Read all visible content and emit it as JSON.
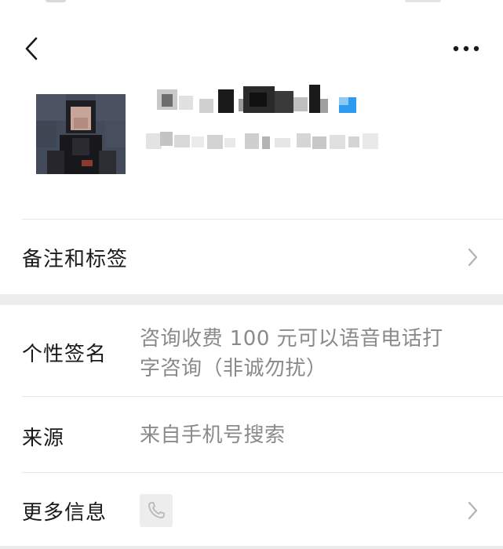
{
  "contact": {
    "name": "",
    "wechat_id": ""
  },
  "rows": {
    "remark": {
      "label": "备注和标签"
    },
    "signature": {
      "label": "个性签名",
      "value_line1": "咨询收费 100 元可以语音电话打",
      "value_line2": "字咨询（非诚勿扰）"
    },
    "source": {
      "label": "来源",
      "value": "来自手机号搜索"
    },
    "more_info": {
      "label": "更多信息"
    }
  },
  "icons": {
    "back": "chevron-left-icon",
    "more": "more-dots-icon",
    "chevron": "chevron-right-icon",
    "phone": "phone-icon"
  },
  "colors": {
    "background": "#ffffff",
    "section_gap": "#ededed",
    "divider": "#e6e6e6",
    "label_text": "#1a1a1a",
    "value_text": "#8a8a8a",
    "chevron": "#b2b2b2",
    "gender_badge": "#2f9bf0"
  }
}
